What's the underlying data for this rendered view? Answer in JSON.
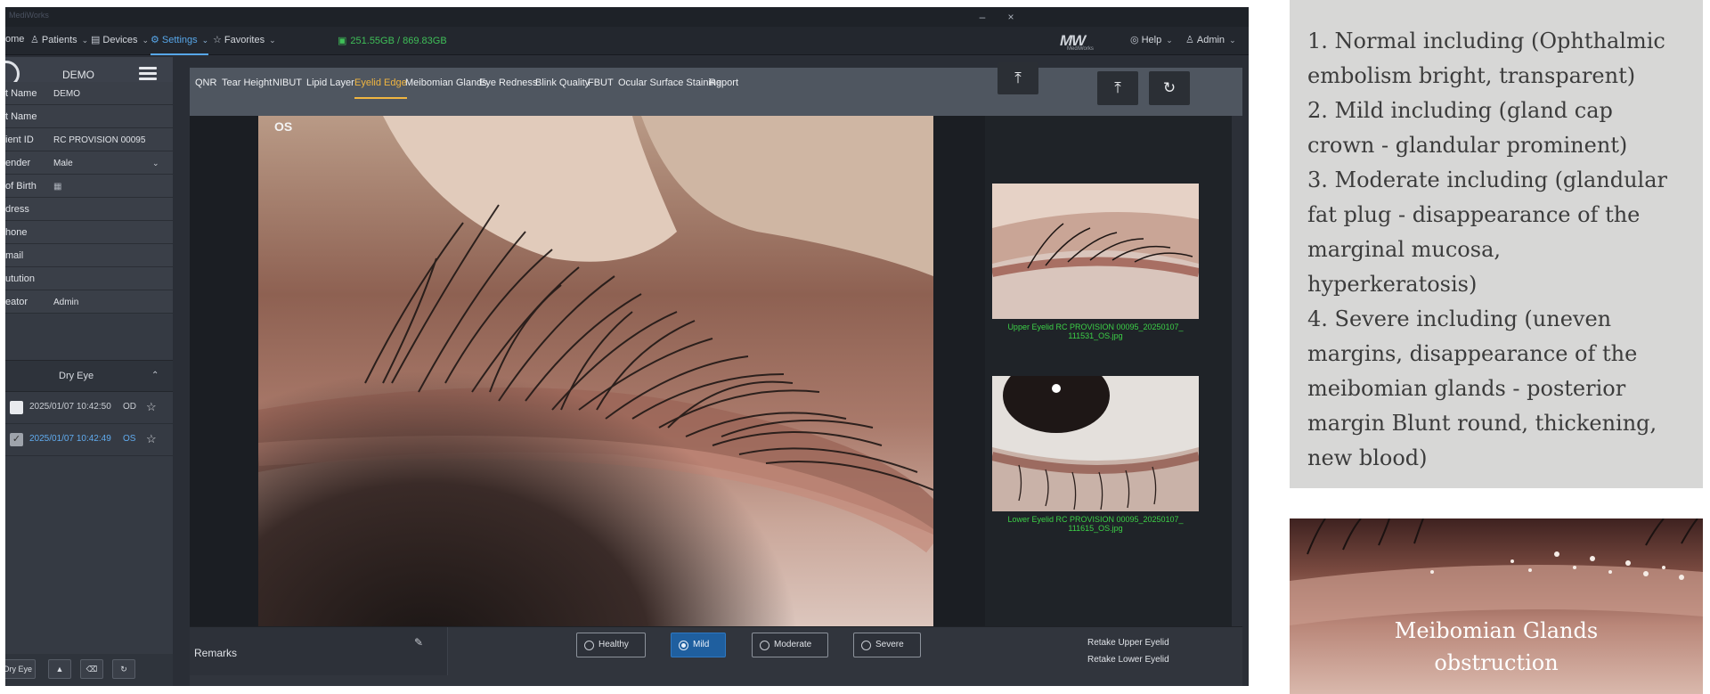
{
  "window": {
    "title": "MediWorks",
    "minimize_icon": "minimize-icon",
    "close_icon": "close-icon"
  },
  "menubar": {
    "items": [
      {
        "label": "ome",
        "icon": "home-icon"
      },
      {
        "label": "Patients",
        "icon": "users-icon"
      },
      {
        "label": "Devices",
        "icon": "devices-icon"
      },
      {
        "label": "Settings",
        "icon": "gear-icon"
      },
      {
        "label": "Favorites",
        "icon": "star-icon"
      }
    ],
    "storage": "251.55GB / 869.83GB",
    "logo_text": "MW",
    "logo_sub": "MediWorks",
    "help_label": "Help",
    "admin_label": "Admin"
  },
  "sidebar": {
    "profile_name": "DEMO",
    "fields": [
      {
        "label": "t Name",
        "value": "DEMO"
      },
      {
        "label": "t Name",
        "value": ""
      },
      {
        "label": "ient ID",
        "value": "RC PROVISION 00095"
      },
      {
        "label": "ender",
        "value": "Male"
      },
      {
        "label": " of Birth",
        "value": ""
      },
      {
        "label": "dress",
        "value": ""
      },
      {
        "label": "hone",
        "value": ""
      },
      {
        "label": "mail",
        "value": ""
      },
      {
        "label": "utution",
        "value": ""
      },
      {
        "label": "eator",
        "value": "Admin"
      }
    ],
    "section_title": "Dry Eye",
    "records": [
      {
        "date": "2025/01/07 10:42:50",
        "eye": "OD"
      },
      {
        "date": "2025/01/07 10:42:49",
        "eye": "OS"
      }
    ],
    "actions": {
      "dry_eye": "Dry Eye"
    }
  },
  "tabs": [
    "QNR",
    "Tear Height",
    "NIBUT",
    "Lipid Layer",
    "Eyelid Edge",
    "Meibomian Glands",
    "Eye Redness",
    "Blink Quality",
    "FBUT",
    "Ocular Surface Staining",
    "Report"
  ],
  "viewer": {
    "eye_label": "OS",
    "thumbnails": [
      {
        "caption_1": "Upper Eyelid RC PROVISION 00095_20250107_",
        "caption_2": "111531_OS.jpg"
      },
      {
        "caption_1": "Lower Eyelid RC PROVISION 00095_20250107_",
        "caption_2": "111615_OS.jpg"
      }
    ]
  },
  "bottombar": {
    "remarks_label": "Remarks",
    "grades": [
      {
        "label": "Healthy",
        "selected": false
      },
      {
        "label": "Mild",
        "selected": true
      },
      {
        "label": "Moderate",
        "selected": false
      },
      {
        "label": "Severe",
        "selected": false
      }
    ],
    "retake_upper": "Retake Upper Eyelid",
    "retake_lower": "Retake Lower Eyelid"
  },
  "notes": {
    "lines": [
      "1. Normal including (Ophthalmic",
      "embolism bright, transparent)",
      "2. Mild including (gland cap",
      "crown - glandular prominent)",
      "3. Moderate including (glandular",
      "fat plug - disappearance of the",
      "marginal mucosa,",
      "hyperkeratosis)",
      "4. Severe including (uneven",
      "margins, disappearance of the",
      "meibomian glands - posterior",
      "margin Blunt round, thickening,",
      "new blood)"
    ],
    "image_caption_1": "Meibomian Glands",
    "image_caption_2": "obstruction"
  },
  "colors": {
    "accent_blue": "#57a6e8",
    "active_tab": "#f0b540",
    "storage_green": "#3fbf58",
    "caption_green": "#3cd047"
  }
}
